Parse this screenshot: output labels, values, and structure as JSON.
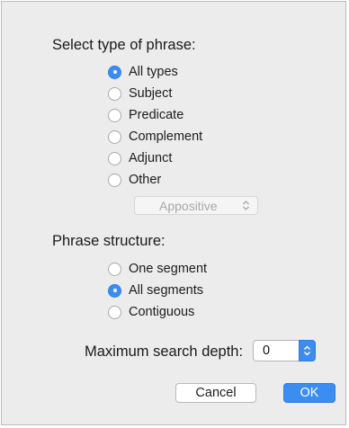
{
  "phrase_type": {
    "heading": "Select type of phrase:",
    "options": [
      {
        "label": "All types",
        "selected": true
      },
      {
        "label": "Subject",
        "selected": false
      },
      {
        "label": "Predicate",
        "selected": false
      },
      {
        "label": "Complement",
        "selected": false
      },
      {
        "label": "Adjunct",
        "selected": false
      },
      {
        "label": "Other",
        "selected": false
      }
    ],
    "other_popup": {
      "value": "Appositive",
      "enabled": false
    }
  },
  "phrase_structure": {
    "heading": "Phrase structure:",
    "options": [
      {
        "label": "One segment",
        "selected": false
      },
      {
        "label": "All segments",
        "selected": true
      },
      {
        "label": "Contiguous",
        "selected": false
      }
    ]
  },
  "search_depth": {
    "label": "Maximum search depth:",
    "value": "0"
  },
  "buttons": {
    "cancel": "Cancel",
    "ok": "OK"
  },
  "colors": {
    "accent": "#3b8df1",
    "background": "#ececec"
  },
  "icons": {
    "popup": "up-down-chevron-icon",
    "stepper": "stepper-arrows-icon"
  }
}
